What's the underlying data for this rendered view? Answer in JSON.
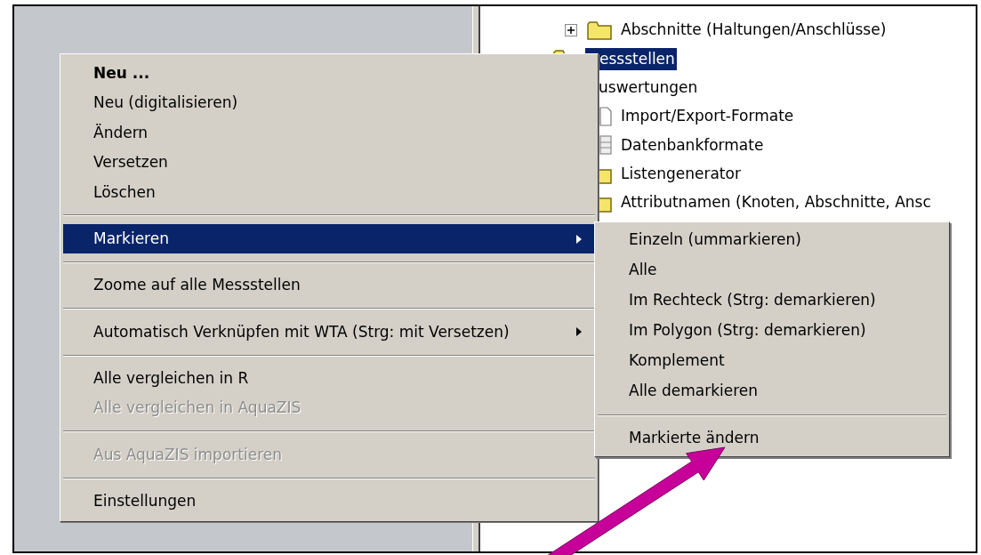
{
  "tree": {
    "items": [
      {
        "children": [
          {
            "label": "Abschnitte (Haltungen/Anschlüsse)",
            "kind": "folder",
            "expanded": false,
            "selected": false
          }
        ]
      },
      {
        "label": "essstellen",
        "kind": "folder",
        "selected": true
      },
      {
        "label": "uswertungen",
        "selected": false,
        "children": [
          {
            "label": "Import/Export-Formate",
            "kind": "document",
            "selected": false
          },
          {
            "label": "Datenbankformate",
            "kind": "database",
            "selected": false
          },
          {
            "label": "Listengenerator",
            "kind": "folder",
            "selected": false
          },
          {
            "label": "Attributnamen (Knoten, Abschnitte, Ansc",
            "kind": "folder",
            "selected": false
          }
        ]
      }
    ]
  },
  "context_menu": {
    "items": [
      {
        "kind": "item",
        "label": "Neu ...",
        "default": true,
        "disabled": false,
        "selected": false,
        "submenu": false
      },
      {
        "kind": "item",
        "label": "Neu (digitalisieren)",
        "default": false,
        "disabled": false,
        "selected": false,
        "submenu": false
      },
      {
        "kind": "item",
        "label": "Ändern",
        "default": false,
        "disabled": false,
        "selected": false,
        "submenu": false
      },
      {
        "kind": "item",
        "label": "Versetzen",
        "default": false,
        "disabled": false,
        "selected": false,
        "submenu": false
      },
      {
        "kind": "item",
        "label": "Löschen",
        "default": false,
        "disabled": false,
        "selected": false,
        "submenu": false
      },
      {
        "kind": "separator"
      },
      {
        "kind": "item",
        "label": "Markieren",
        "default": false,
        "disabled": false,
        "selected": true,
        "submenu": true
      },
      {
        "kind": "separator"
      },
      {
        "kind": "item",
        "label": "Zoome auf alle Messstellen",
        "default": false,
        "disabled": false,
        "selected": false,
        "submenu": false
      },
      {
        "kind": "separator"
      },
      {
        "kind": "item",
        "label": "Automatisch Verknüpfen mit WTA (Strg: mit Versetzen)",
        "default": false,
        "disabled": false,
        "selected": false,
        "submenu": true
      },
      {
        "kind": "separator"
      },
      {
        "kind": "item",
        "label": "Alle vergleichen in R",
        "default": false,
        "disabled": false,
        "selected": false,
        "submenu": false
      },
      {
        "kind": "item",
        "label": "Alle vergleichen in AquaZIS",
        "default": false,
        "disabled": true,
        "selected": false,
        "submenu": false
      },
      {
        "kind": "separator"
      },
      {
        "kind": "item",
        "label": "Aus AquaZIS importieren",
        "default": false,
        "disabled": true,
        "selected": false,
        "submenu": false
      },
      {
        "kind": "separator"
      },
      {
        "kind": "item",
        "label": "Einstellungen",
        "default": false,
        "disabled": false,
        "selected": false,
        "submenu": false
      }
    ]
  },
  "submenu": {
    "items": [
      {
        "kind": "item",
        "label": "Einzeln (ummarkieren)",
        "disabled": false,
        "selected": false
      },
      {
        "kind": "item",
        "label": "Alle",
        "disabled": false,
        "selected": false
      },
      {
        "kind": "item",
        "label": "Im Rechteck (Strg: demarkieren)",
        "disabled": false,
        "selected": false
      },
      {
        "kind": "item",
        "label": "Im Polygon (Strg: demarkieren)",
        "disabled": false,
        "selected": false
      },
      {
        "kind": "item",
        "label": "Komplement",
        "disabled": false,
        "selected": false
      },
      {
        "kind": "item",
        "label": "Alle demarkieren",
        "disabled": false,
        "selected": false
      },
      {
        "kind": "separator"
      },
      {
        "kind": "item",
        "label": "Markierte ändern",
        "disabled": false,
        "selected": false
      }
    ]
  }
}
